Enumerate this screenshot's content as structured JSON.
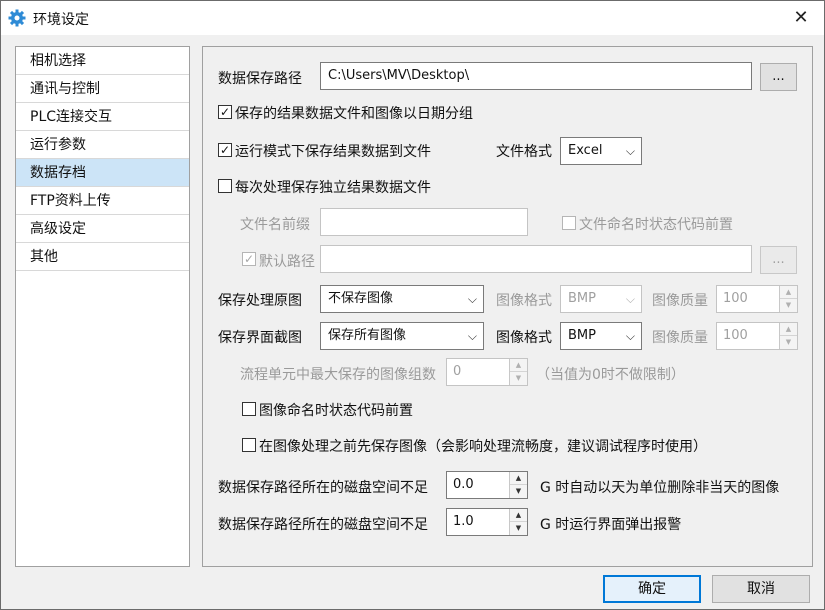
{
  "window": {
    "title": "环境设定",
    "close_glyph": "✕"
  },
  "sidebar": {
    "items": [
      {
        "label": "相机选择"
      },
      {
        "label": "通讯与控制"
      },
      {
        "label": "PLC连接交互"
      },
      {
        "label": "运行参数"
      },
      {
        "label": "数据存档"
      },
      {
        "label": "FTP资料上传"
      },
      {
        "label": "高级设定"
      },
      {
        "label": "其他"
      }
    ],
    "active_index": 4
  },
  "form": {
    "save_path_label": "数据保存路径",
    "save_path_value": "C:\\Users\\MV\\Desktop\\",
    "browse_label": "...",
    "group_by_date_label": "保存的结果数据文件和图像以日期分组",
    "group_by_date_checked": true,
    "save_in_run_label": "运行模式下保存结果数据到文件",
    "save_in_run_checked": true,
    "file_format_label": "文件格式",
    "file_format_value": "Excel",
    "independent_file_label": "每次处理保存独立结果数据文件",
    "independent_file_checked": false,
    "file_prefix_label": "文件名前缀",
    "file_prefix_value": "",
    "status_code_prefix_label": "文件命名时状态代码前置",
    "status_code_prefix_checked": false,
    "default_path_label": "默认路径",
    "default_path_checked": true,
    "default_path_value": "",
    "default_browse_label": "...",
    "save_raw_label": "保存处理原图",
    "save_raw_value": "不保存图像",
    "raw_format_label": "图像格式",
    "raw_format_value": "BMP",
    "raw_quality_label": "图像质量",
    "raw_quality_value": "100",
    "save_screen_label": "保存界面截图",
    "save_screen_value": "保存所有图像",
    "screen_format_label": "图像格式",
    "screen_format_value": "BMP",
    "screen_quality_label": "图像质量",
    "screen_quality_value": "100",
    "max_groups_label": "流程单元中最大保存的图像组数",
    "max_groups_value": "0",
    "max_groups_hint": "（当值为0时不做限制）",
    "image_status_prefix_label": "图像命名时状态代码前置",
    "image_status_prefix_checked": false,
    "save_before_process_label": "在图像处理之前先保存图像（会影响处理流畅度，建议调试程序时使用）",
    "save_before_process_checked": false,
    "disk_low1_label": "数据保存路径所在的磁盘空间不足",
    "disk_low1_value": "0.0",
    "disk_low1_suffix": "G 时自动以天为单位删除非当天的图像",
    "disk_low2_label": "数据保存路径所在的磁盘空间不足",
    "disk_low2_value": "1.0",
    "disk_low2_suffix": "G 时运行界面弹出报警"
  },
  "footer": {
    "ok_label": "确定",
    "cancel_label": "取消"
  },
  "icons": {
    "app": "gear-icon",
    "dropdown": "chevron-down-icon",
    "spin_up": "triangle-up-icon",
    "spin_down": "triangle-down-icon",
    "check": "checkmark-icon"
  },
  "colors": {
    "selection": "#cce4f7",
    "accent": "#0078d7",
    "app_icon": "#2e8bd6"
  }
}
